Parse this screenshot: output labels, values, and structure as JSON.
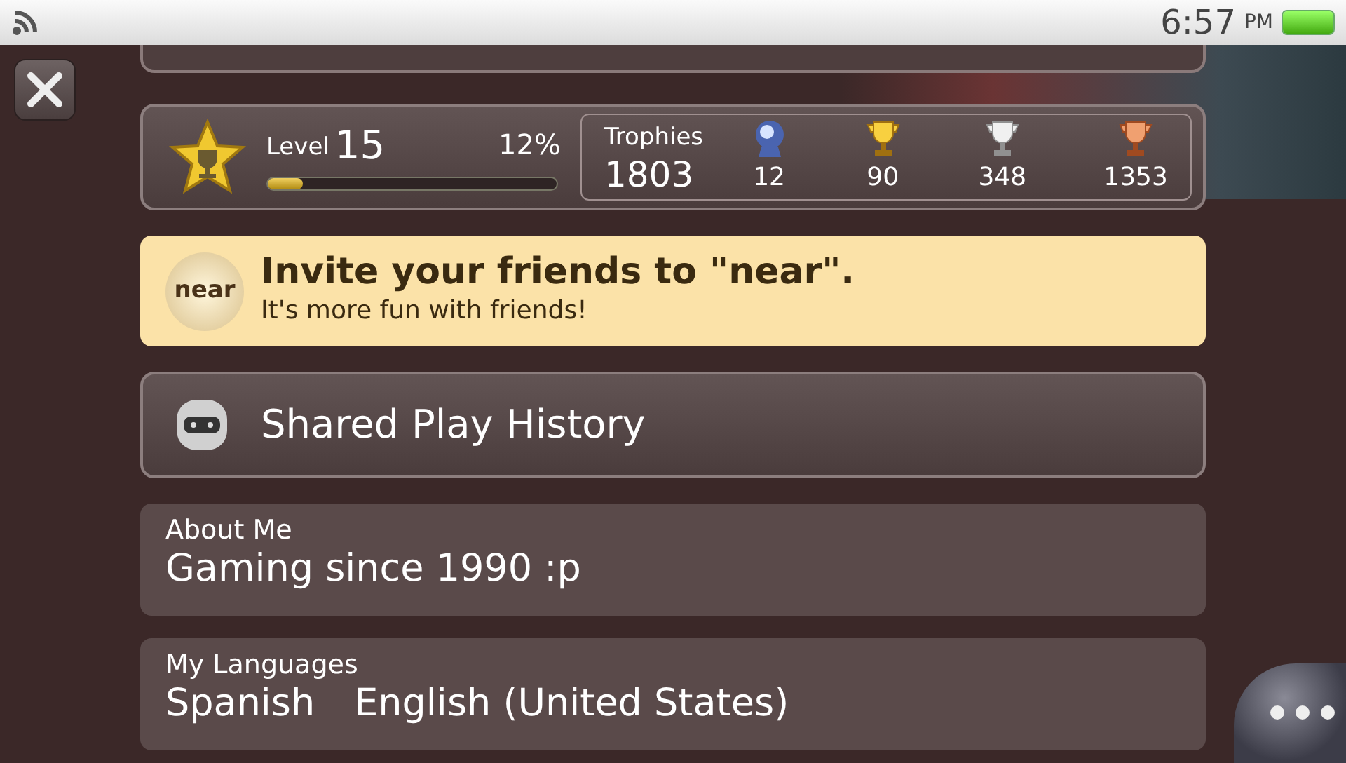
{
  "status_bar": {
    "time": "6:57",
    "ampm": "PM"
  },
  "level_card": {
    "label": "Level",
    "level_value": "15",
    "percent": "12%",
    "level": 0.12
  },
  "trophies": {
    "label": "Trophies",
    "total": "1803",
    "counts": [
      {
        "kind": "platinum",
        "count": "12"
      },
      {
        "kind": "gold",
        "count": "90"
      },
      {
        "kind": "silver",
        "count": "348"
      },
      {
        "kind": "bronze",
        "count": "1353"
      }
    ]
  },
  "invite_banner": {
    "logo_text": "near",
    "title": "Invite your friends to \"near\".",
    "subtitle": "It's more fun with friends!"
  },
  "shared_play": {
    "label": "Shared Play History"
  },
  "sections": [
    {
      "heading": "About Me",
      "values": [
        "Gaming since 1990 :p"
      ]
    },
    {
      "heading": "My Languages",
      "values": [
        "Spanish",
        "English (United States)"
      ]
    }
  ]
}
